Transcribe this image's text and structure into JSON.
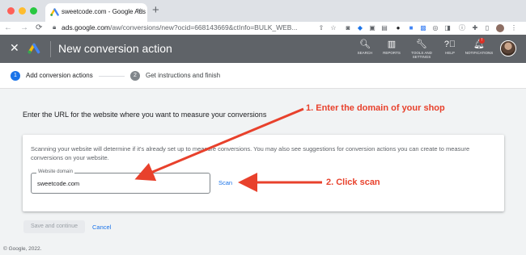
{
  "browser": {
    "tab_title": "sweetcode.com - Google Ads",
    "tab_close": "×",
    "new_tab": "+",
    "url_host": "ads.google.com",
    "url_path": "/aw/conversions/new?ocid=668143669&ctInfo=BULK_WEB...",
    "extensions": [
      "share-icon",
      "star-icon",
      "camera-icon",
      "tag-icon",
      "ext-icon",
      "ext-icon",
      "ext-icon",
      "ext-icon",
      "ext-icon",
      "ext-icon",
      "ext-icon",
      "info-icon",
      "puzzle-icon",
      "sidebar-icon",
      "profile-icon",
      "menu-icon"
    ]
  },
  "ads_header": {
    "close": "✕",
    "title": "New conversion action",
    "nav": [
      {
        "label": "SEARCH",
        "icon": "search-icon"
      },
      {
        "label": "REPORTS",
        "icon": "reports-icon"
      },
      {
        "label": "TOOLS AND SETTINGS",
        "icon": "tools-icon"
      },
      {
        "label": "HELP",
        "icon": "help-icon"
      },
      {
        "label": "NOTIFICATIONS",
        "icon": "bell-icon",
        "badge": "!"
      }
    ]
  },
  "stepper": {
    "steps": [
      {
        "number": "1",
        "label": "Add conversion actions"
      },
      {
        "number": "2",
        "label": "Get instructions and finish"
      }
    ]
  },
  "main": {
    "heading": "Enter the URL for the website where you want to measure your conversions",
    "description": "Scanning your website will determine if it's already set up to measure conversions. You may also see suggestions for conversion actions you can create to measure conversions on your website.",
    "field_label": "Website domain",
    "field_value": "sweetcode.com",
    "scan_label": "Scan",
    "save_label": "Save and continue",
    "cancel_label": "Cancel"
  },
  "footer": "© Google, 2022.",
  "annotations": {
    "step1": "1. Enter the domain of your shop",
    "step2": "2. Click scan"
  },
  "colors": {
    "accent": "#1a73e8",
    "annotation": "#e8412c",
    "header_bg": "#5f6368"
  }
}
